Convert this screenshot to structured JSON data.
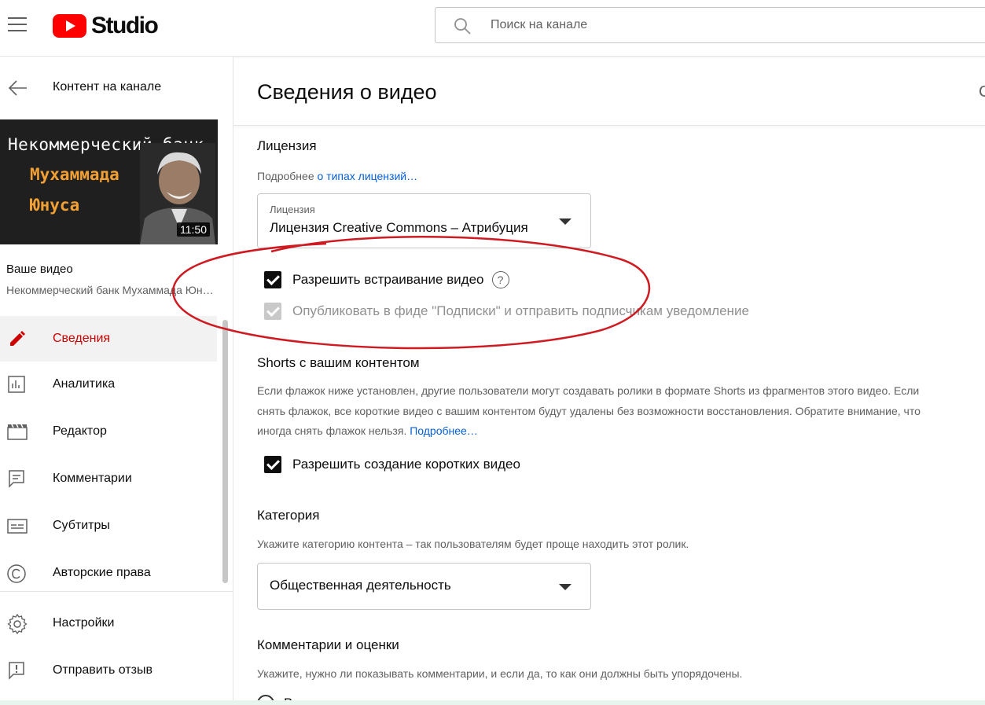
{
  "app": {
    "logo_text": "Studio",
    "search_placeholder": "Поиск на канале"
  },
  "sidebar": {
    "back_label": "Контент на канале",
    "thumbnail": {
      "line1": "Некоммерческий банк",
      "line2": "Мухаммада",
      "line3": "Юнуса",
      "duration": "11:50"
    },
    "your_video_label": "Ваше видео",
    "video_title": "Некоммерческий банк Мухаммада Юнуса",
    "items": [
      {
        "label": "Сведения",
        "icon": "pencil-icon",
        "active": true
      },
      {
        "label": "Аналитика",
        "icon": "analytics-icon",
        "active": false
      },
      {
        "label": "Редактор",
        "icon": "clapperboard-icon",
        "active": false
      },
      {
        "label": "Комментарии",
        "icon": "comment-icon",
        "active": false
      },
      {
        "label": "Субтитры",
        "icon": "subtitles-icon",
        "active": false
      },
      {
        "label": "Авторские права",
        "icon": "copyright-icon",
        "active": false
      }
    ],
    "bottom_items": [
      {
        "label": "Настройки",
        "icon": "gear-icon"
      },
      {
        "label": "Отправить отзыв",
        "icon": "feedback-icon"
      }
    ]
  },
  "main": {
    "page_title": "Сведения о видео",
    "header_edge_char": "С",
    "license": {
      "title": "Лицензия",
      "desc_prefix": "Подробнее ",
      "desc_link": "о типах лицензий…",
      "select_label": "Лицензия",
      "select_value": "Лицензия Creative Commons – Атрибуция"
    },
    "checkboxes": {
      "embed_label": "Разрешить встраивание видео",
      "publish_label": "Опубликовать в фиде \"Подписки\" и отправить подписчикам уведомление"
    },
    "shorts": {
      "title": "Shorts с вашим контентом",
      "desc": "Если флажок ниже установлен, другие пользователи могут создавать ролики в формате Shorts из фрагментов этого видео. Если снять флажок, все короткие видео с вашим контентом будут удалены без возможности восстановления. Обратите внимание, что иногда снять флажок нельзя. ",
      "desc_link": "Подробнее…",
      "checkbox_label": "Разрешить создание коротких видео"
    },
    "category": {
      "title": "Категория",
      "desc": "Укажите категорию контента – так пользователям будет проще находить этот ролик.",
      "select_value": "Общественная деятельность"
    },
    "comments": {
      "title": "Комментарии и оценки",
      "desc": "Укажите, нужно ли показывать комментарии, и если да, то как они должны быть упорядочены.",
      "radio_partial": "В"
    }
  },
  "colors": {
    "brand_red": "#ff0000",
    "active_red": "#cc0000",
    "link_blue": "#065fd4",
    "annotation_red": "#d01a22"
  }
}
